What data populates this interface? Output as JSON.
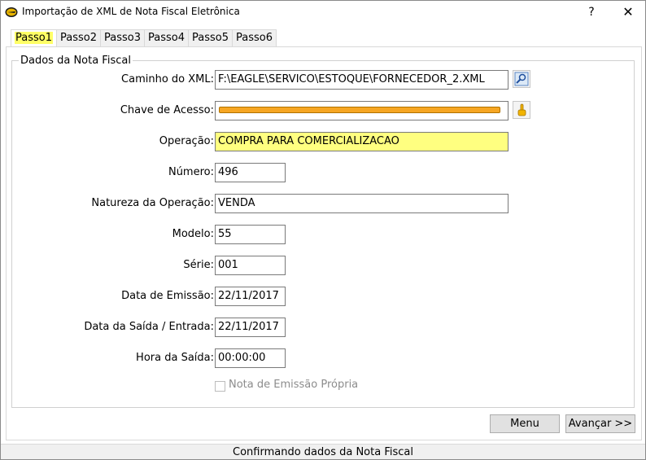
{
  "window": {
    "title": "Importação de XML de Nota Fiscal Eletrônica",
    "help_label": "?",
    "close_label": "✕"
  },
  "tabs": [
    {
      "label": "Passo1",
      "active": true
    },
    {
      "label": "Passo2",
      "active": false
    },
    {
      "label": "Passo3",
      "active": false
    },
    {
      "label": "Passo4",
      "active": false
    },
    {
      "label": "Passo5",
      "active": false
    },
    {
      "label": "Passo6",
      "active": false
    }
  ],
  "group": {
    "legend": "Dados da Nota Fiscal"
  },
  "fields": {
    "caminho_xml": {
      "label": "Caminho do XML:",
      "value": "F:\\EAGLE\\SERVICO\\ESTOQUE\\FORNECEDOR_2.XML"
    },
    "chave_acesso": {
      "label": "Chave de Acesso:",
      "value": ""
    },
    "operacao": {
      "label": "Operação:",
      "value": "COMPRA PARA COMERCIALIZACAO"
    },
    "numero": {
      "label": "Número:",
      "value": "496"
    },
    "natureza": {
      "label": "Natureza da Operação:",
      "value": "VENDA"
    },
    "modelo": {
      "label": "Modelo:",
      "value": "55"
    },
    "serie": {
      "label": "Série:",
      "value": "001"
    },
    "data_emissao": {
      "label": "Data de Emissão:",
      "value": "22/11/2017"
    },
    "data_saida": {
      "label": "Data da Saída / Entrada:",
      "value": "22/11/2017"
    },
    "hora_saida": {
      "label": "Hora da Saída:",
      "value": "00:00:00"
    }
  },
  "checkbox": {
    "label": "Nota de Emissão Própria",
    "checked": false,
    "enabled": false
  },
  "buttons": {
    "menu": "Menu",
    "avancar": "Avançar >>"
  },
  "icons": {
    "app": "eagle-logo-icon",
    "browse": "search-folder-icon",
    "key": "hand-pointer-icon"
  },
  "colors": {
    "highlight_yellow": "#ffff80",
    "tab_highlight": "#ffff66",
    "redacted_orange": "#f6a623"
  },
  "status": {
    "text": "Confirmando dados da Nota Fiscal"
  }
}
